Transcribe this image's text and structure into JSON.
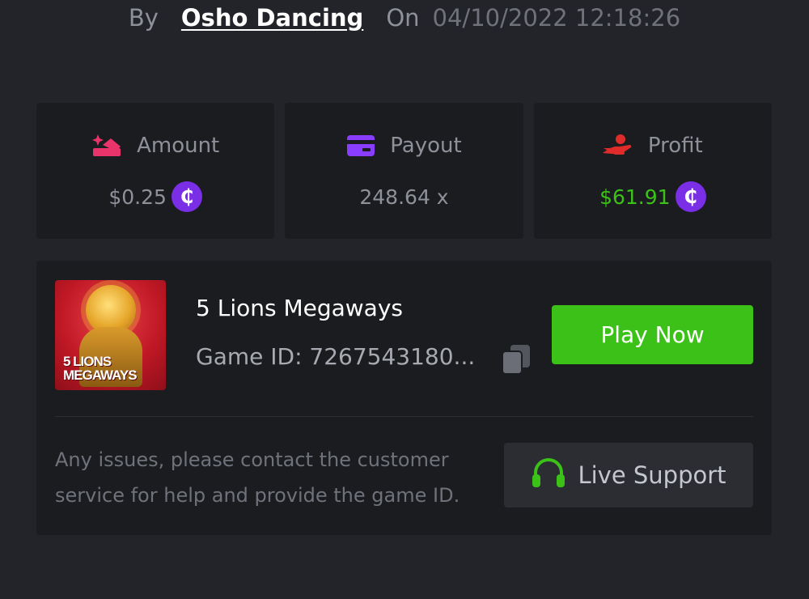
{
  "header": {
    "by_label": "By",
    "username": "Osho Dancing",
    "on_label": "On",
    "datetime": "04/10/2022 12:18:26"
  },
  "stats": {
    "amount": {
      "label": "Amount",
      "value": "$0.25",
      "icon": "amount-icon",
      "color": "#e8336b"
    },
    "payout": {
      "label": "Payout",
      "value": "248.64 x",
      "icon": "card-icon",
      "color": "#8b3dff"
    },
    "profit": {
      "label": "Profit",
      "value": "$61.91",
      "icon": "hand-coin-icon",
      "color": "#e02b2b",
      "value_color": "#3bc117"
    }
  },
  "currency": {
    "symbol": "₵",
    "color": "#7a2ee6"
  },
  "game": {
    "title": "5 Lions Megaways",
    "id_text": "Game ID: 7267543180...",
    "thumbnail_lines": [
      "5 LIONS",
      "MEGAWAYS"
    ],
    "play_label": "Play Now"
  },
  "support": {
    "help_text": "Any issues, please contact the customer service for help and provide the game ID.",
    "button_label": "Live Support"
  },
  "colors": {
    "background": "#232429",
    "card": "#1b1c20",
    "accent_green": "#3bc117",
    "support_button": "#2c2d33"
  }
}
